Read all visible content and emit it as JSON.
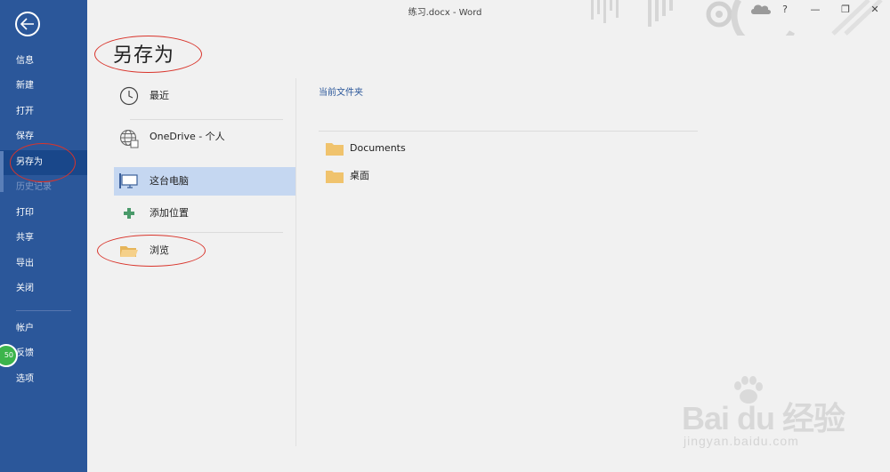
{
  "window": {
    "title": "练习.docx  -  Word",
    "help": "?",
    "minimize": "—",
    "restore": "❐",
    "close": "✕"
  },
  "nav": {
    "items": [
      {
        "label": "信息"
      },
      {
        "label": "新建"
      },
      {
        "label": "打开"
      },
      {
        "label": "保存"
      },
      {
        "label": "另存为"
      },
      {
        "label": "历史记录"
      },
      {
        "label": "打印"
      },
      {
        "label": "共享"
      },
      {
        "label": "导出"
      },
      {
        "label": "关闭"
      },
      {
        "label": "帐户"
      },
      {
        "label": "反馈"
      },
      {
        "label": "选项"
      }
    ],
    "badge": "50"
  },
  "page": {
    "title": "另存为"
  },
  "places": [
    {
      "label": "最近",
      "icon": "clock-icon"
    },
    {
      "label": "OneDrive - 个人",
      "icon": "globe-icon"
    },
    {
      "label": "这台电脑",
      "icon": "computer-icon",
      "selected": true
    },
    {
      "label": "添加位置",
      "icon": "plus-icon"
    },
    {
      "label": "浏览",
      "icon": "folder-open-icon"
    }
  ],
  "right": {
    "section_title": "当前文件夹",
    "folders": [
      {
        "label": "Documents"
      },
      {
        "label": "桌面"
      }
    ]
  },
  "watermark": {
    "main": "Bai du 经验",
    "sub": "jingyan.baidu.com"
  },
  "colors": {
    "nav_bg": "#2b579a",
    "nav_active": "#19478a",
    "selected_place": "#c5d7f1",
    "annotation": "#d9342b",
    "folder": "#f0c36d"
  }
}
